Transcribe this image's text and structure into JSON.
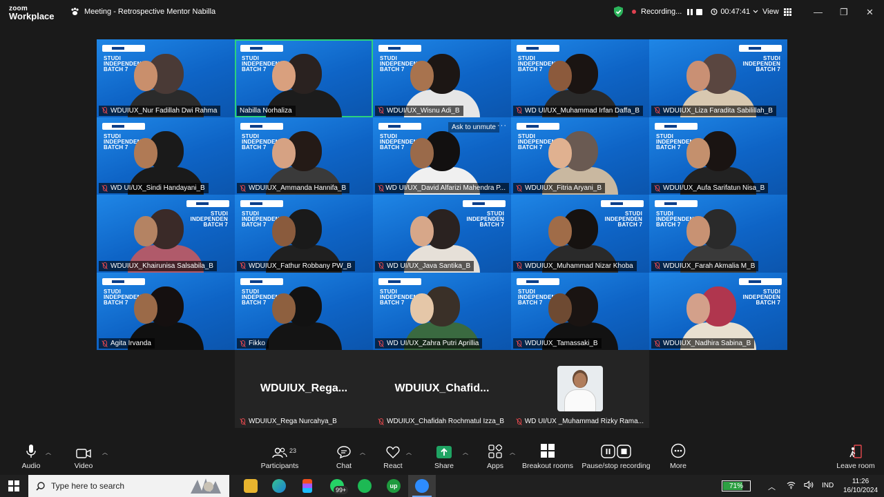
{
  "app": {
    "logo_line1": "zoom",
    "logo_line2": "Workplace"
  },
  "meeting": {
    "title": "Meeting - Retrospective Mentor Nabilla"
  },
  "recording": {
    "label": "Recording...",
    "timer": "00:47:41"
  },
  "view_label": "View",
  "tile_brand": "STUDI INDEPENDEN BATCH 7",
  "participants_grid": [
    {
      "name": "WDUIUX_Nur Fadillah Dwi Rahma",
      "muted": true
    },
    {
      "name": "Nabilla Norhaliza",
      "muted": false
    },
    {
      "name": "WDUI/UX_Wisnu Adi_B",
      "muted": true
    },
    {
      "name": "WD UI/UX_Muhammad Irfan Daffa_B",
      "muted": true
    },
    {
      "name": "WDUIUX_Liza Faradita Sabilillah_B",
      "muted": true
    },
    {
      "name": "WD UI/UX_Sindi Handayani_B",
      "muted": true
    },
    {
      "name": "WDUIUX_Ammanda Hannifa_B",
      "muted": true
    },
    {
      "name": "WD UI/UX_David Alfarizi Mahendra P...",
      "muted": true
    },
    {
      "name": "WDUIUX_Fitria Aryani_B",
      "muted": true
    },
    {
      "name": "WDUI/UX_Aufa Sarifatun Nisa_B",
      "muted": true
    },
    {
      "name": "WDUIUX_Khairunisa Salsabila_B",
      "muted": true
    },
    {
      "name": "WDUIUX_Fathur Robbany PW_B",
      "muted": true
    },
    {
      "name": "WD UI/UX_Java Santika_B",
      "muted": true
    },
    {
      "name": "WDUIUX_Muhammad Nizar Khoba",
      "muted": true
    },
    {
      "name": "WDUIUX_Farah Akmalia M_B",
      "muted": true
    },
    {
      "name": "Agita Irvanda",
      "muted": true
    },
    {
      "name": "Fikko",
      "muted": true
    },
    {
      "name": "WD UI/UX_Zahra Putri Aprillia",
      "muted": true
    },
    {
      "name": "WDUIUX_Tamassaki_B",
      "muted": true
    },
    {
      "name": "WDUIUX_Nadhira Sabina_B",
      "muted": true
    }
  ],
  "ask_to_unmute": "Ask to unmute",
  "more_dots": "···",
  "strip": [
    {
      "big": "WDUIUX_Rega...",
      "name": "WDUIUX_Rega Nurcahya_B"
    },
    {
      "big": "WDUIUX_Chafid...",
      "name": "WDUIUX_Chafidah Rochmatul Izza_B"
    },
    {
      "big": "",
      "name": "WD UI/UX _Muhammad Rizky Rama..."
    }
  ],
  "toolbar": {
    "audio": "Audio",
    "video": "Video",
    "participants": "Participants",
    "participants_count": "23",
    "chat": "Chat",
    "react": "React",
    "share": "Share",
    "apps": "Apps",
    "breakout": "Breakout rooms",
    "pause_stop": "Pause/stop recording",
    "more": "More",
    "leave": "Leave room"
  },
  "taskbar": {
    "search_placeholder": "Type here to search",
    "whatsapp_badge": "99+",
    "battery": "71%",
    "lang": "IND",
    "time": "11:26",
    "date": "16/10/2024"
  },
  "colors": {
    "tile_blue": "#1579d8",
    "active_border": "#2bd27c",
    "share_green": "#1fa463",
    "mute_red": "#e5484d"
  }
}
